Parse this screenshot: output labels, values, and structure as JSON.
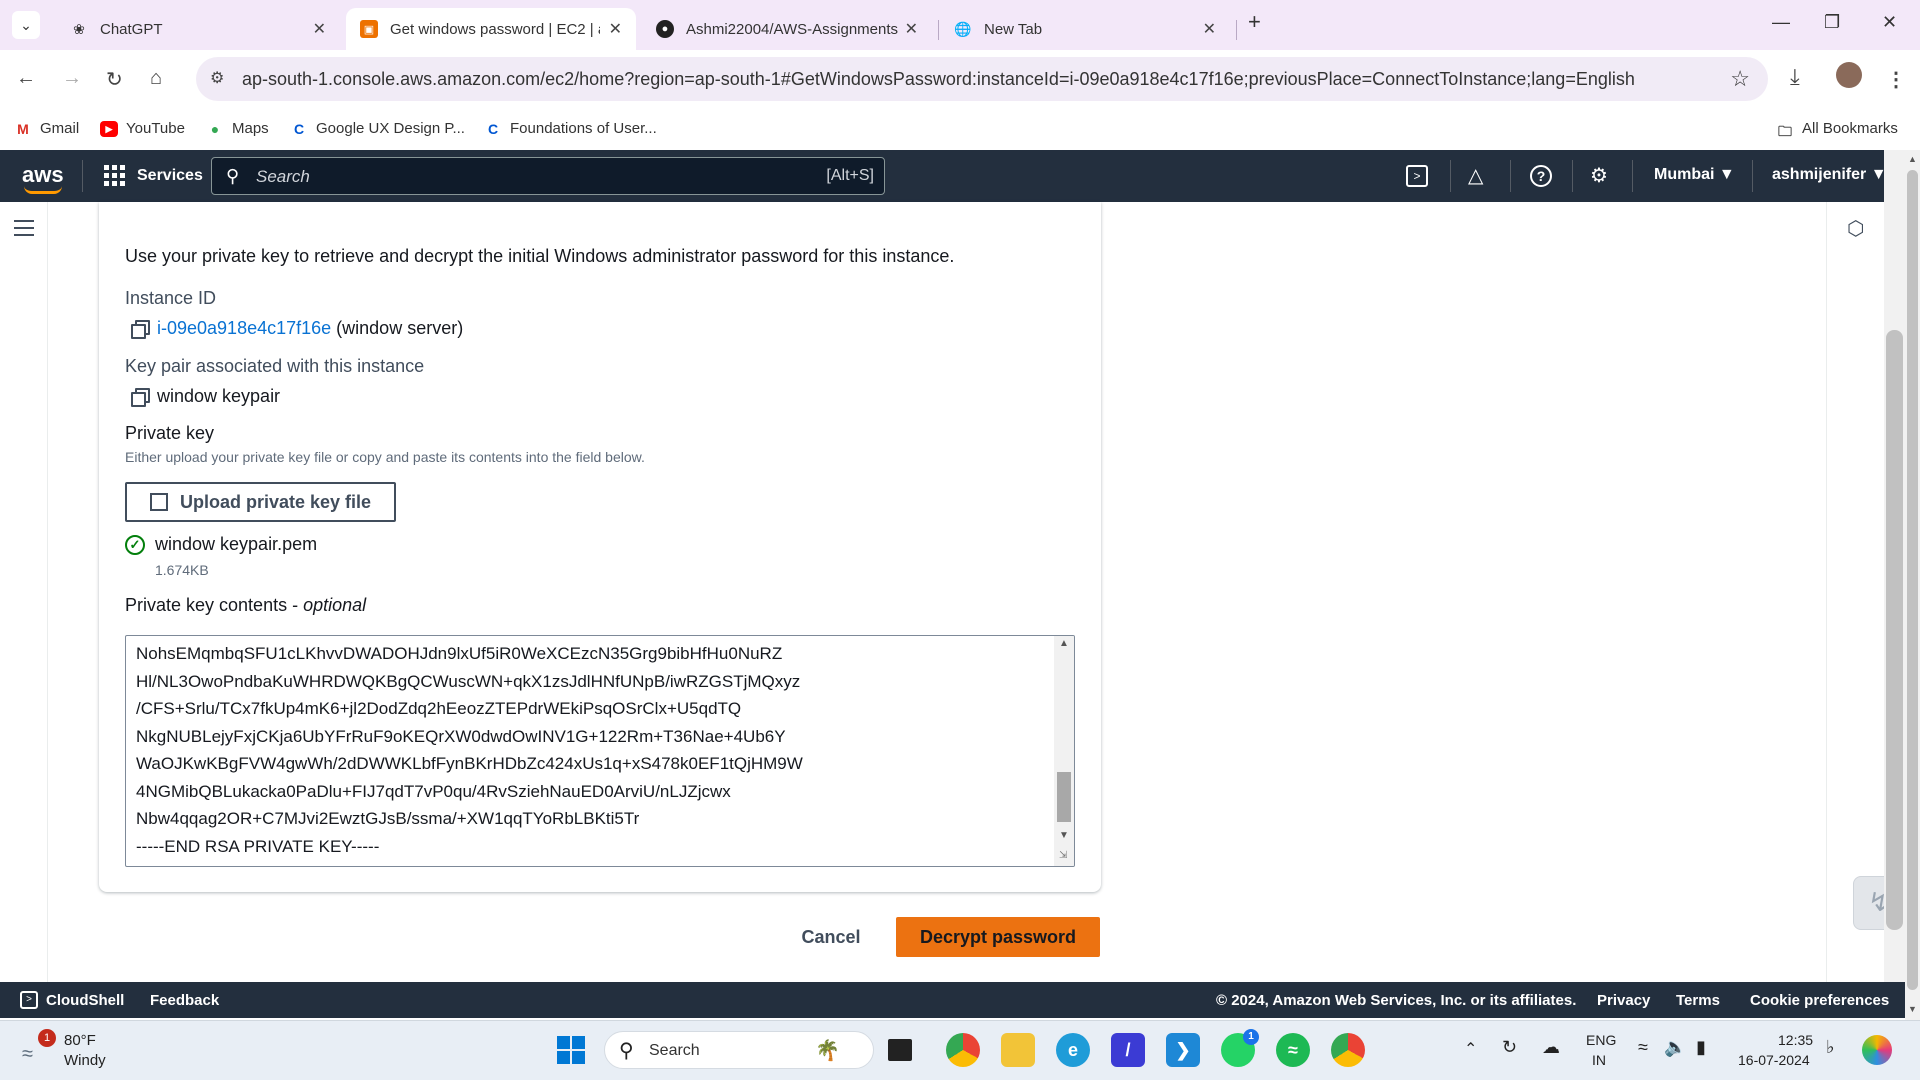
{
  "browser": {
    "tabs": [
      {
        "title": "ChatGPT",
        "icon": "chatgpt-icon"
      },
      {
        "title": "Get windows password | EC2 | a",
        "icon": "aws-ec2-icon"
      },
      {
        "title": "Ashmi22004/AWS-Assignments",
        "icon": "github-icon"
      },
      {
        "title": "New Tab",
        "icon": "globe-icon"
      }
    ],
    "url": "ap-south-1.console.aws.amazon.com/ec2/home?region=ap-south-1#GetWindowsPassword:instanceId=i-09e0a918e4c17f16e;previousPlace=ConnectToInstance;lang=English",
    "bookmarks": [
      "Gmail",
      "YouTube",
      "Maps",
      "Google UX Design P...",
      "Foundations of User..."
    ],
    "all_bookmarks": "All Bookmarks"
  },
  "aws_header": {
    "logo": "aws",
    "services": "Services",
    "search_placeholder": "Search",
    "search_shortcut": "[Alt+S]",
    "region": "Mumbai",
    "user": "ashmijenifer"
  },
  "content": {
    "intro": "Use your private key to retrieve and decrypt the initial Windows administrator password for this instance.",
    "instance_label": "Instance ID",
    "instance_id": "i-09e0a918e4c17f16e",
    "instance_name": "(window server)",
    "keypair_label": "Key pair associated with this instance",
    "keypair_value": "window keypair",
    "private_key_label": "Private key",
    "private_key_desc": "Either upload your private key file or copy and paste its contents into the field below.",
    "upload_button": "Upload private key file",
    "file_name": "window keypair.pem",
    "file_size": "1.674KB",
    "contents_label": "Private key contents - ",
    "contents_optional": "optional",
    "key_lines": [
      "NohsEMqmbqSFU1cLKhvvDWADOHJdn9lxUf5iR0WeXCEzcN35Grg9bibHfHu0NuRZ",
      "Hl/NL3OwoPndbaKuWHRDWQKBgQCWuscWN+qkX1zsJdlHNfUNpB/iwRZGSTjMQxyz",
      "/CFS+Srlu/TCx7fkUp4mK6+jl2DodZdq2hEeozZTEPdrWEkiPsqOSrClx+U5qdTQ",
      "NkgNUBLejyFxjCKja6UbYFrRuF9oKEQrXW0dwdOwINV1G+122Rm+T36Nae+4Ub6Y",
      "WaOJKwKBgFVW4gwWh/2dDWWKLbfFynBKrHDbZc424xUs1q+xS478k0EF1tQjHM9W",
      "4NGMibQBLukacka0PaDlu+FIJ7qdT7vP0qu/4RvSziehNauED0ArviU/nLJZjcwx",
      "Nbw4qqag2OR+C7MJvi2EwztGJsB/ssma/+XW1qqTYoRbLBKti5Tr",
      "-----END RSA PRIVATE KEY-----"
    ],
    "cancel": "Cancel",
    "decrypt": "Decrypt password"
  },
  "footer": {
    "cloudshell": "CloudShell",
    "feedback": "Feedback",
    "copyright": "© 2024, Amazon Web Services, Inc. or its affiliates.",
    "privacy": "Privacy",
    "terms": "Terms",
    "cookies": "Cookie preferences"
  },
  "taskbar": {
    "weather_temp": "80°F",
    "weather_desc": "Windy",
    "weather_badge": "1",
    "search": "Search",
    "lang1": "ENG",
    "lang2": "IN",
    "time": "12:35",
    "date": "16-07-2024",
    "whatsapp_badge": "1"
  },
  "colors": {
    "aws_orange": "#ec7211",
    "aws_nav": "#232f3e",
    "link": "#0972d3",
    "success": "#037f0c"
  }
}
